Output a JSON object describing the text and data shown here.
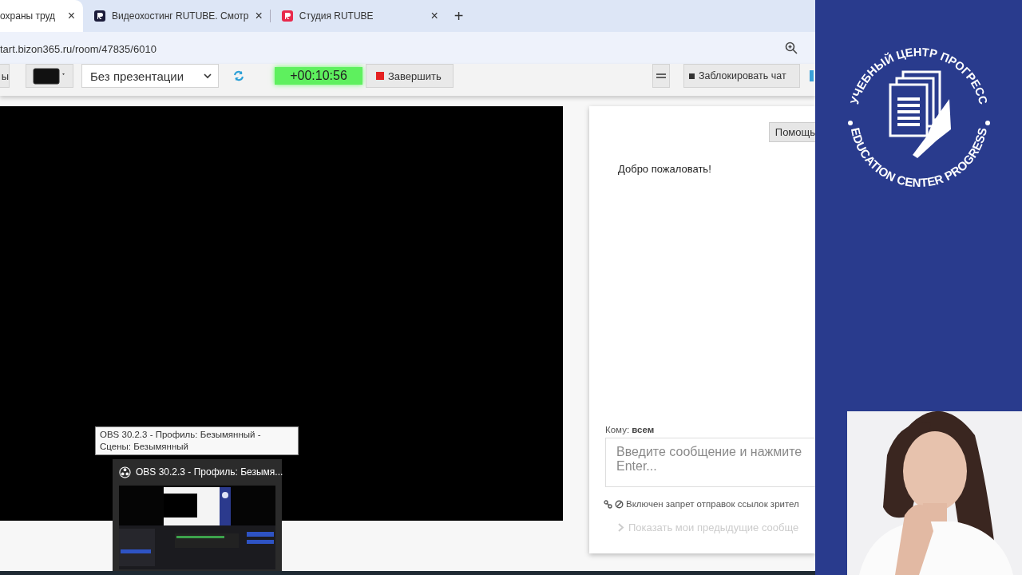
{
  "browser": {
    "tabs": [
      {
        "title": "охраны труд",
        "selected": true,
        "close": "×"
      },
      {
        "title": "Видеохостинг RUTUBE. Смотр",
        "selected": false,
        "close": "×",
        "color": "#1c1c3a"
      },
      {
        "title": "Студия RUTUBE",
        "selected": false,
        "close": "×",
        "color": "#e8294c"
      }
    ],
    "new_tab": "+",
    "address": "tart.bizon365.ru/room/47835/6010"
  },
  "toolbar": {
    "cut_button": "ы",
    "presentation_select": "Без презентации",
    "timer": "+00:10:56",
    "finish_button": "Завершить",
    "lock_chat_button": "Заблокировать чат"
  },
  "chat": {
    "help_button": "Помощь",
    "welcome": "Добро пожаловать!",
    "recipient_label": "Кому:",
    "recipient": "всем",
    "message_placeholder": "Введите сообщение и нажмите Enter...",
    "links_notice": "Включен запрет отправок ссылок зрител",
    "show_previous": "Показать мои предыдущие сообще"
  },
  "taskbar": {
    "tooltip": "OBS 30.2.3 - Профиль: Безымянный - Сцены: Безымянный",
    "preview_title": "OBS 30.2.3 - Профиль: Безымя..."
  },
  "logo": {
    "top_text": "УЧЕБНЫЙ ЦЕНТР ПРОГРЕСС",
    "bottom_text": "EDUCATION CENTER PROGRESS"
  }
}
